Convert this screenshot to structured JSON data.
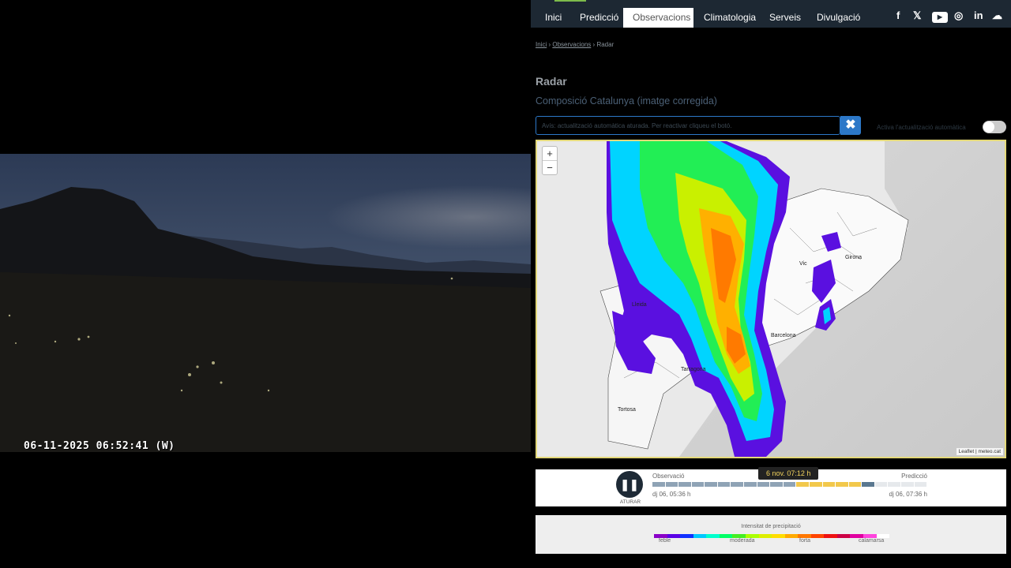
{
  "webcam": {
    "timestamp": "06-11-2025 06:52:41  (W)"
  },
  "nav": {
    "items": [
      "Inici",
      "Predicció",
      "Observacions",
      "Climatologia",
      "Serveis",
      "Divulgació"
    ],
    "active_index": 2,
    "social": [
      "facebook-icon",
      "x-icon",
      "youtube-icon",
      "instagram-icon",
      "linkedin-icon",
      "soundcloud-icon"
    ],
    "social_glyphs": [
      "f",
      "𝕏",
      "▶",
      "◎",
      "in",
      "☁"
    ]
  },
  "breadcrumb": {
    "home": "Inici",
    "section": "Observacions",
    "current": "Radar",
    "sep": "›"
  },
  "page": {
    "title": "Radar",
    "subtitle": "Composició Catalunya (imatge corregida)"
  },
  "notice": {
    "text": "Avís: actualització automàtica aturada. Per reactivar cliqueu el botó.",
    "close_icon": "✖",
    "auto_update_label": "Activa l'actualització automàtica",
    "auto_update_on": false
  },
  "map": {
    "zoom_in": "+",
    "zoom_out": "−",
    "attribution": "Leaflet | meteo.cat",
    "places": [
      "Lleida",
      "Vic",
      "Girona",
      "Barcelona",
      "Tarragona",
      "Tortosa"
    ]
  },
  "timeline": {
    "play_symbol": "❚❚",
    "play_label": "ATURAR",
    "observation_label": "Observació",
    "prediction_label": "Predicció",
    "start_time": "dj 06, 05:36 h",
    "end_time": "dj 06, 07:36 h",
    "current_time": "6 nov. 07:12 h",
    "observation_color": "#8fa3b5",
    "prediction_color": "#f2c84b",
    "current_color": "#5a7890"
  },
  "legend": {
    "title": "Intensitat de precipitació",
    "labels": [
      "feble",
      "moderada",
      "forta",
      "calamarsa"
    ],
    "colors": [
      "#8a00c8",
      "#5a00e6",
      "#1030ff",
      "#00c8ff",
      "#00ffcc",
      "#00ff66",
      "#44ee22",
      "#aaff00",
      "#ddee00",
      "#ffdd00",
      "#ffaa00",
      "#ff7700",
      "#ff4400",
      "#ee1111",
      "#cc0044",
      "#e000a0",
      "#ff44dd",
      "#ffffff"
    ]
  }
}
